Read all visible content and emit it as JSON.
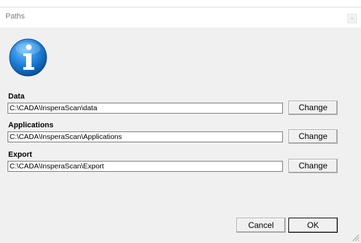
{
  "window": {
    "title": "Paths",
    "close_glyph": "×"
  },
  "icon": "info-icon",
  "fields": [
    {
      "label": "Data",
      "value": "C:\\CADA\\InsperaScan\\data",
      "button": "Change"
    },
    {
      "label": "Applications",
      "value": "C:\\CADA\\InsperaScan\\Applications",
      "button": "Change"
    },
    {
      "label": "Export",
      "value": "C:\\CADA\\InsperaScan\\Export",
      "button": "Change"
    }
  ],
  "buttons": {
    "cancel": "Cancel",
    "ok": "OK"
  },
  "colors": {
    "dialog_bg": "#f0f0f0",
    "icon_blue": "#1e7fd6"
  }
}
